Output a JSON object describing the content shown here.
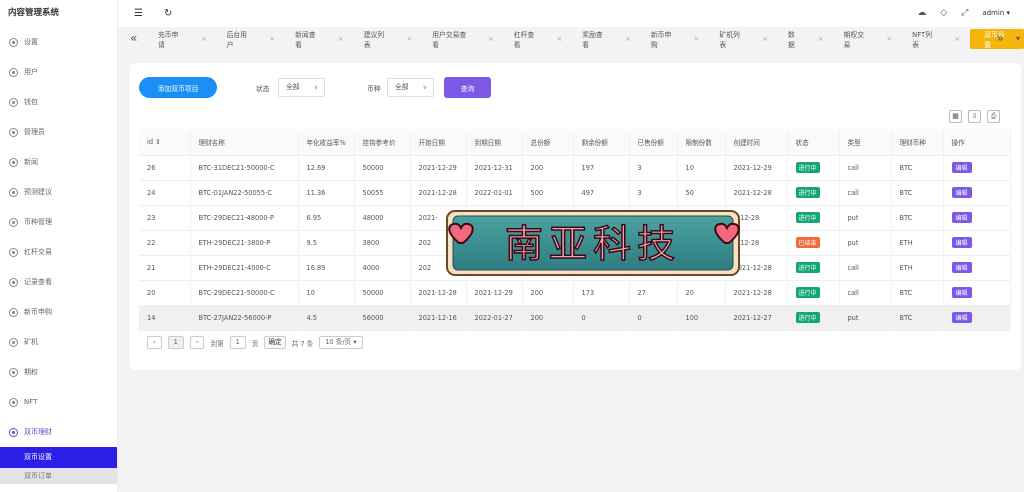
{
  "brand": "内容管理系统",
  "sidebar": {
    "items": [
      {
        "label": "设置",
        "icon": "settings-icon"
      },
      {
        "label": "用户",
        "icon": "user-icon"
      },
      {
        "label": "钱包",
        "icon": "wallet-icon"
      },
      {
        "label": "管理员",
        "icon": "admin-icon"
      },
      {
        "label": "新闻",
        "icon": "news-icon"
      },
      {
        "label": "预测建议",
        "icon": "suggest-icon"
      },
      {
        "label": "币种管理",
        "icon": "coin-icon"
      },
      {
        "label": "杠杆交易",
        "icon": "leverage-icon"
      },
      {
        "label": "记录查看",
        "icon": "record-icon"
      },
      {
        "label": "新币申购",
        "icon": "new-coin-icon"
      },
      {
        "label": "矿机",
        "icon": "miner-icon"
      },
      {
        "label": "期权",
        "icon": "option-icon"
      },
      {
        "label": "NFT",
        "icon": "nft-icon"
      },
      {
        "label": "双币理财",
        "icon": "dual-coin-icon"
      }
    ],
    "sub_items": [
      "双币设置",
      "双币订单"
    ]
  },
  "header": {
    "user": "admin"
  },
  "tabs": [
    "充币申请",
    "后台用户",
    "新闻查看",
    "建议列表",
    "用户交易查看",
    "杠杆查看",
    "奖励查看",
    "新币申购",
    "矿机列表",
    "数据",
    "期权交易",
    "NFT列表",
    "双币设置"
  ],
  "filters": {
    "add_button": "添加双币项目",
    "status_label": "状态",
    "status_value": "全部",
    "coin_label": "币种",
    "coin_value": "全部",
    "query_button": "查询"
  },
  "table": {
    "columns": [
      "id",
      "理财名称",
      "年化收益率%",
      "挂钩参考价",
      "开始日期",
      "到期日期",
      "总份额",
      "剩余份额",
      "已售份额",
      "限制份数",
      "创建时间",
      "状态",
      "类型",
      "理财币种",
      "操作"
    ],
    "rows": [
      {
        "id": "26",
        "name": "BTC-31DEC21-50000-C",
        "rate": "12.69",
        "ref": "50000",
        "start": "2021-12-29",
        "end": "2021-12-31",
        "total": "200",
        "remain": "197",
        "sold": "3",
        "limit": "10",
        "created": "2021-12-29",
        "status": "进行中",
        "type": "call",
        "coin": "BTC",
        "op": "编辑"
      },
      {
        "id": "24",
        "name": "BTC-01JAN22-50055-C",
        "rate": "11.36",
        "ref": "50055",
        "start": "2021-12-28",
        "end": "2022-01-01",
        "total": "500",
        "remain": "497",
        "sold": "3",
        "limit": "50",
        "created": "2021-12-28",
        "status": "进行中",
        "type": "call",
        "coin": "BTC",
        "op": "编辑"
      },
      {
        "id": "23",
        "name": "BTC-29DEC21-48000-P",
        "rate": "6.95",
        "ref": "48000",
        "start": "2021-",
        "end": "",
        "total": "",
        "remain": "",
        "sold": "",
        "limit": "",
        "created": "1-12-28",
        "status": "进行中",
        "type": "put",
        "coin": "BTC",
        "op": "编辑"
      },
      {
        "id": "22",
        "name": "ETH-29DEC21-3800-P",
        "rate": "9.5",
        "ref": "3800",
        "start": "202",
        "end": "",
        "total": "",
        "remain": "",
        "sold": "",
        "limit": "",
        "created": "1-12-28",
        "status": "已结束",
        "type": "put",
        "coin": "ETH",
        "op": "编辑"
      },
      {
        "id": "21",
        "name": "ETH-29DEC21-4000-C",
        "rate": "16.89",
        "ref": "4000",
        "start": "202",
        "end": "",
        "total": "",
        "remain": "",
        "sold": "",
        "limit": "",
        "created": "2021-12-28",
        "status": "进行中",
        "type": "call",
        "coin": "ETH",
        "op": "编辑"
      },
      {
        "id": "20",
        "name": "BTC-29DEC21-50000-C",
        "rate": "10",
        "ref": "50000",
        "start": "2021-12-28",
        "end": "2021-12-29",
        "total": "200",
        "remain": "173",
        "sold": "27",
        "limit": "20",
        "created": "2021-12-28",
        "status": "进行中",
        "type": "call",
        "coin": "BTC",
        "op": "编辑"
      },
      {
        "id": "14",
        "name": "BTC-27JAN22-56000-P",
        "rate": "4.5",
        "ref": "56000",
        "start": "2021-12-16",
        "end": "2022-01-27",
        "total": "200",
        "remain": "0",
        "sold": "0",
        "limit": "100",
        "created": "2021-12-27",
        "status": "进行中",
        "type": "put",
        "coin": "BTC",
        "op": "编辑"
      }
    ]
  },
  "pager": {
    "page": "1",
    "goto_label": "到第",
    "goto_value": "1",
    "page_unit": "页",
    "confirm": "确定",
    "total": "共 7 条",
    "per_page": "10 条/页"
  },
  "watermark": {
    "text": "南亚科技"
  },
  "colors": {
    "primary": "#1a8ff5",
    "purple": "#7b59e6",
    "active_tab": "#f5b50a",
    "status_ok": "#13a873",
    "status_end": "#f26b3d",
    "sidebar_selected": "#2b1ee6"
  }
}
